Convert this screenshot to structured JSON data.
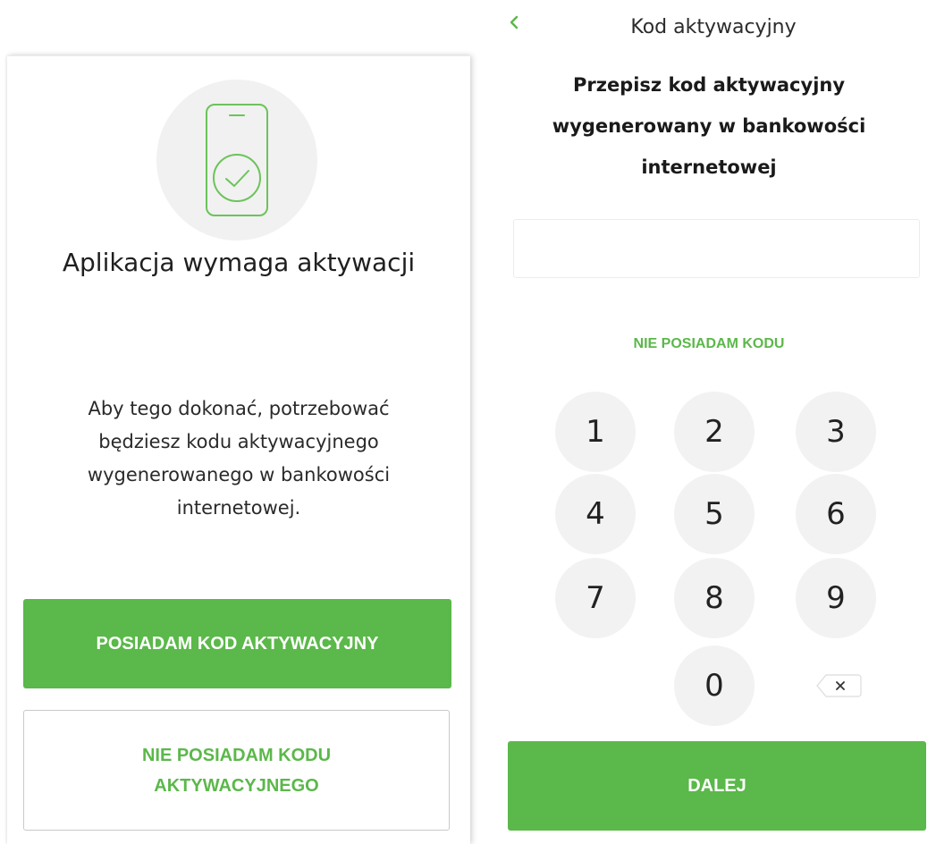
{
  "left_screen": {
    "title": "Aplikacja wymaga aktywacji",
    "description": "Aby tego dokonać, potrzebować będziesz kodu aktywacyjnego wygenerowanego w bankowości internetowej.",
    "have_code_button": "POSIADAM KOD AKTYWACYJNY",
    "no_code_button": "NIE POSIADAM KODU AKTYWACYJNEGO",
    "illustration_icon": "phone-check-icon"
  },
  "right_screen": {
    "header_title": "Kod aktywacyjny",
    "back_icon": "chevron-left-icon",
    "instruction": "Przepisz kod aktywacyjny wygenerowany w bankowości internetowej",
    "code_input_value": "",
    "no_code_link": "NIE POSIADAM KODU",
    "keypad": [
      "1",
      "2",
      "3",
      "4",
      "5",
      "6",
      "7",
      "8",
      "9",
      "0"
    ],
    "backspace_icon": "backspace-icon",
    "next_button": "DALEJ"
  },
  "colors": {
    "accent": "#5bb84a",
    "key_background": "#f2f2f2",
    "illustration_background": "#f1f1f1"
  }
}
